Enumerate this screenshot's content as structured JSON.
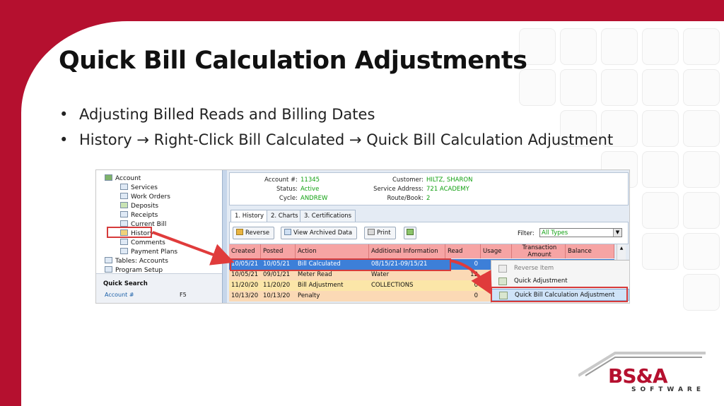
{
  "slide": {
    "title": "Quick Bill Calculation Adjustments",
    "bullets": [
      "Adjusting Billed Reads and Billing Dates",
      "History → Right-Click Bill Calculated → Quick Bill Calculation Adjustment"
    ],
    "accent_color": "#b5102f"
  },
  "tree": {
    "items": [
      "Account",
      "Services",
      "Work Orders",
      "Deposits",
      "Receipts",
      "Current Bill",
      "History",
      "Comments",
      "Payment Plans",
      "Tables: Accounts",
      "Program Setup"
    ],
    "quick_search_title": "Quick Search",
    "quick_search_rows": [
      {
        "label": "Account #",
        "key": "F5"
      }
    ]
  },
  "account": {
    "account_label": "Account #:",
    "account_value": "11345",
    "status_label": "Status:",
    "status_value": "Active",
    "cycle_label": "Cycle:",
    "cycle_value": "ANDREW",
    "customer_label": "Customer:",
    "customer_value": "HILTZ, SHARON",
    "address_label": "Service Address:",
    "address_value": "721 ACADEMY",
    "route_label": "Route/Book:",
    "route_value": "2"
  },
  "tabs": [
    "1. History",
    "2. Charts",
    "3. Certifications"
  ],
  "toolbar": {
    "reverse": "Reverse",
    "view_archived": "View Archived Data",
    "print": "Print",
    "filter_label": "Filter:",
    "filter_value": "All Types"
  },
  "table": {
    "columns": [
      "Created",
      "Posted",
      "Action",
      "Additional Information",
      "Read",
      "Usage",
      "Transaction Amount",
      "Balance"
    ],
    "rows": [
      {
        "created": "10/05/21",
        "posted": "10/05/21",
        "action": "Bill Calculated",
        "info": "08/15/21-09/15/21",
        "read": "0"
      },
      {
        "created": "10/05/21",
        "posted": "09/01/21",
        "action": "Meter Read",
        "info": "Water",
        "read": "12"
      },
      {
        "created": "11/20/20",
        "posted": "11/20/20",
        "action": "Bill Adjustment",
        "info": "COLLECTIONS",
        "read": "0"
      },
      {
        "created": "10/13/20",
        "posted": "10/13/20",
        "action": "Penalty",
        "info": "",
        "read": "0"
      }
    ]
  },
  "context_menu": {
    "items": [
      "Reverse Item",
      "Quick Adjustment",
      "Quick Bill Calculation Adjustment"
    ]
  },
  "logo": {
    "name": "BS&A",
    "sub": "SOFTWARE"
  }
}
